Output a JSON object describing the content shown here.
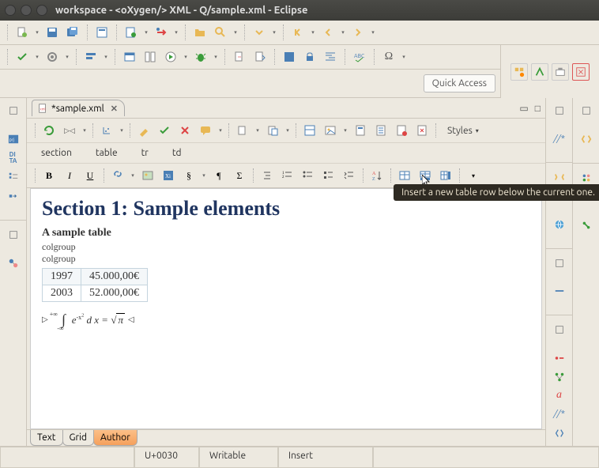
{
  "window": {
    "title": "workspace - <oXygen/> XML - Q/sample.xml - Eclipse"
  },
  "quick_access": "Quick Access",
  "editor": {
    "tab_label": "*sample.xml",
    "styles_label": "Styles",
    "breadcrumb": [
      "section",
      "table",
      "tr",
      "td"
    ],
    "heading": "Section 1: Sample elements",
    "caption": "A sample table",
    "colgroup": "colgroup",
    "rows": [
      {
        "year": "1997",
        "amount": "45.000,00€"
      },
      {
        "year": "2003",
        "amount": "52.000,00€"
      }
    ],
    "math": {
      "lhs_sup": "+∞",
      "lhs_sub": "-∞",
      "expr": "e",
      "exp": "-x",
      "sup2": "2",
      "dx": "d x",
      "eq": "=",
      "sqrt": "√",
      "pi": "π"
    }
  },
  "tooltip": "Insert a new table row below the current one.",
  "views": {
    "text": "Text",
    "grid": "Grid",
    "author": "Author"
  },
  "status": {
    "codepoint": "U+0030",
    "mode": "Writable",
    "insert": "Insert"
  }
}
